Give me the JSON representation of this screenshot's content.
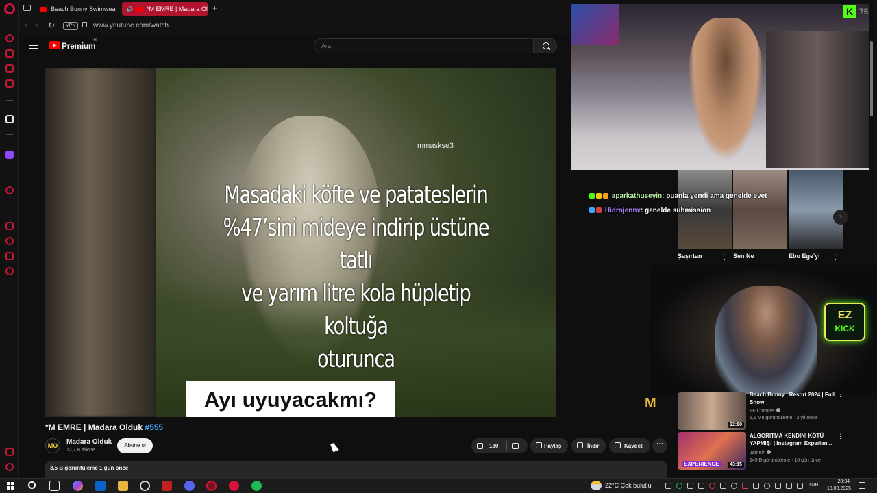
{
  "browser": {
    "tabs": [
      {
        "label": "Beach Bunny Swimwear F"
      },
      {
        "label": "*M EMRE | Madara Ol"
      }
    ],
    "vpn_label": "VPN",
    "url": "www.youtube.com/watch"
  },
  "youtube": {
    "logo_text": "Premium",
    "logo_tr": "TR",
    "search_placeholder": "Ara"
  },
  "video": {
    "watermark": "mmaskse3",
    "caption_lines": [
      "Masadaki köfte ve patateslerin",
      "%47’sini mideye indirip üstüne tatlı",
      "ve yarım litre kola hüpletip koltuğa",
      "oturunca"
    ],
    "question": "Ayı uyuyacakmı?",
    "title": "*M EMRE | Madara Olduk",
    "title_tag": "#555"
  },
  "channel": {
    "avatar_text": "MO",
    "name": "Madara Olduk",
    "subscribers": "12,7 B abone",
    "subscribe_label": "Abone ol"
  },
  "actions": {
    "like_count": "180",
    "share_label": "Paylaş",
    "download_label": "İndir",
    "save_label": "Kaydet",
    "more_label": "⋯"
  },
  "description": {
    "meta": "3,5 B görüntüleme  1 gün önce"
  },
  "stream_overlay": {
    "kick_logo": "K",
    "kick_count": "75",
    "chat": [
      {
        "user": "aparkathuseyin",
        "message": ": puanla yendi ama genelde evet"
      },
      {
        "user": "Hidrojennx",
        "message": ": genelde submission"
      }
    ],
    "ez_kick_top": "EZ",
    "ez_kick_bottom": "KICK",
    "mo_logo": "M"
  },
  "shelf": [
    {
      "label": "Şaşırtan"
    },
    {
      "label": "Sen Ne"
    },
    {
      "label": "Ebo Ege'yi"
    }
  ],
  "side_videos": [
    {
      "title": "Beach Bunny | Resort 2024 | Full Show",
      "channel": "FF Channel",
      "meta": "1,1 Mn görüntüleme · 2 yıl önce",
      "duration": "22:50"
    },
    {
      "title": "ALGORİTMA KENDİNİ KÖTÜ YAPMIŞ! | Instagram Experien...",
      "channel": "Jahrein",
      "meta": "145 B görüntüleme · 10 gün önce",
      "duration": "43:15",
      "thumb_label": "EXPERIENCE"
    }
  ],
  "taskbar": {
    "weather": "22°C  Çok bulutlu",
    "language": "TUR",
    "time": "20:34",
    "date": "18.08.2025"
  },
  "colors": {
    "opera_red": "#d4143b",
    "youtube_red": "#ff0000",
    "kick_green": "#53fc18",
    "link_blue": "#3ea6ff"
  }
}
